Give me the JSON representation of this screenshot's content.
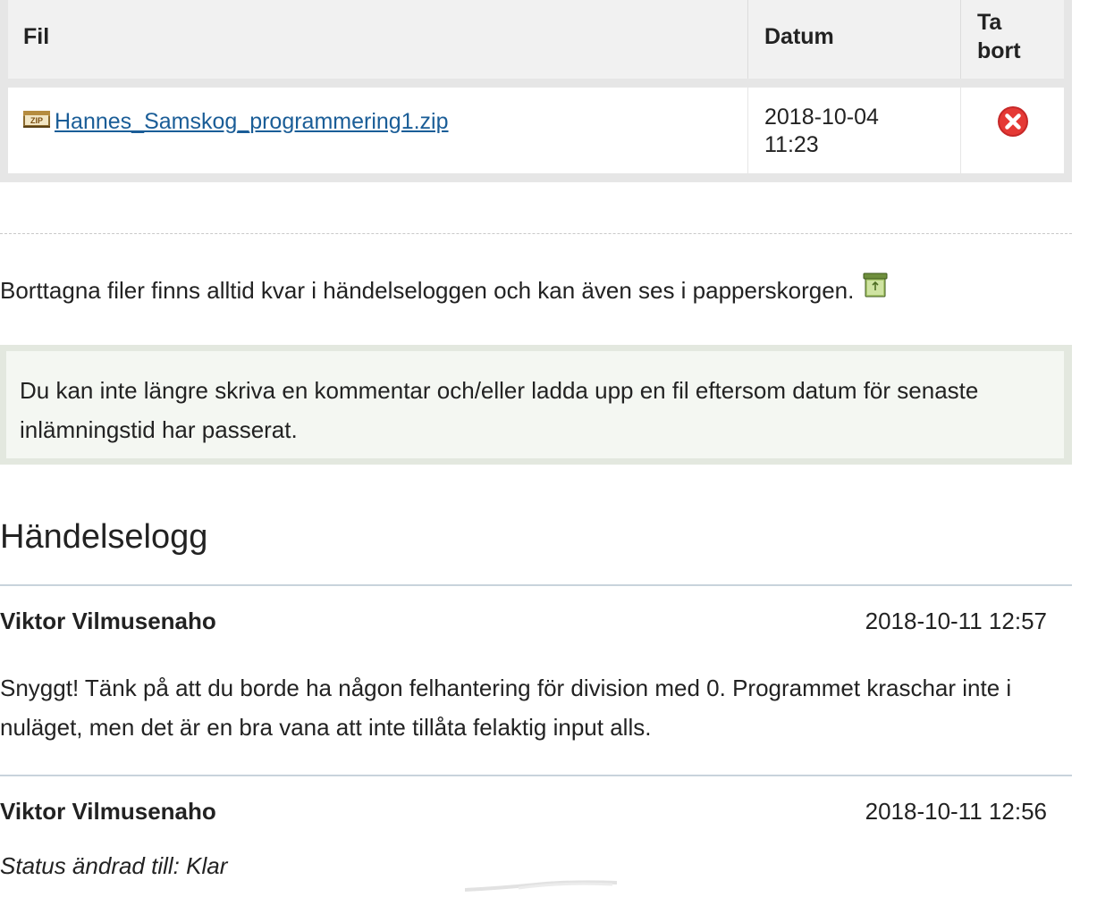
{
  "file_table": {
    "headers": {
      "file": "Fil",
      "date": "Datum",
      "delete_line1": "Ta",
      "delete_line2": "bort"
    },
    "rows": [
      {
        "filename": "Hannes_Samskog_programmering1.zip",
        "icon": "zip-file-icon",
        "date_line1": "2018-10-04",
        "date_line2": "11:23",
        "delete_icon": "red-x-circle-icon"
      }
    ]
  },
  "info": {
    "text": "Borttagna filer finns alltid kvar i händelseloggen och kan även ses i papperskorgen.",
    "icon": "recycle-bin-icon"
  },
  "notice": {
    "text": "Du kan inte längre skriva en kommentar och/eller ladda upp en fil eftersom datum för senaste inlämningstid har passerat."
  },
  "event_log": {
    "title": "Händelselogg",
    "entries": [
      {
        "author": "Viktor Vilmusenaho",
        "time": "2018-10-11 12:57",
        "body": "Snyggt! Tänk på att du borde ha någon felhantering för division med 0. Programmet kraschar inte i nuläget, men det är en bra vana att inte tillåta felaktig input alls."
      },
      {
        "author": "Viktor Vilmusenaho",
        "time": "2018-10-11 12:56",
        "status": "Status ändrad till: Klar"
      }
    ]
  },
  "colors": {
    "link": "#1a5d97",
    "delete_red": "#d32f2f",
    "notice_bg": "#f4f7f2",
    "divider": "#c8d3dc"
  }
}
